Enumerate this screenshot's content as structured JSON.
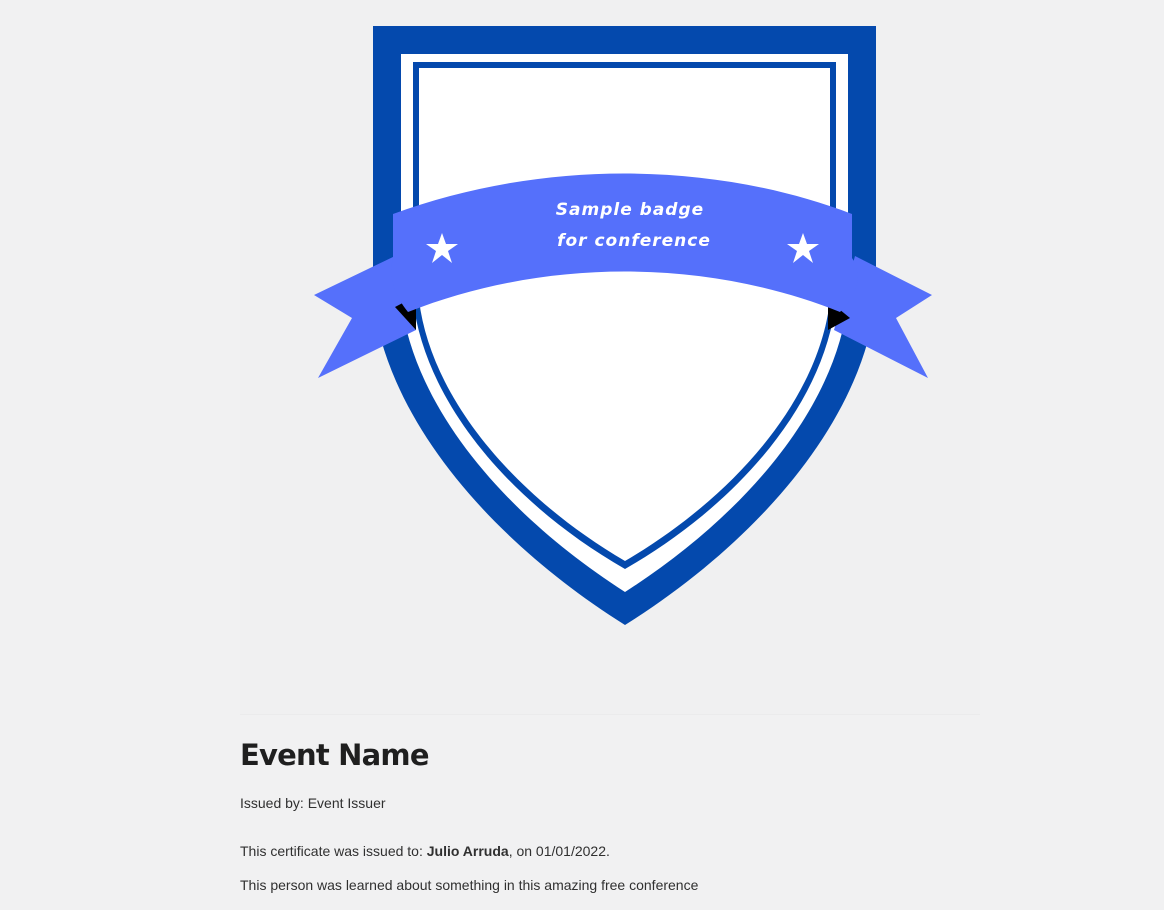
{
  "badge": {
    "ribbon_line1": "Sample badge",
    "ribbon_line2": "for conference",
    "colors": {
      "shield_blue": "#0449ad",
      "ribbon_blue": "#5570fb",
      "white": "#ffffff",
      "background": "#f0f0f1"
    }
  },
  "event": {
    "title": "Event Name",
    "issuer_prefix": "Issued by: ",
    "issuer_name": "Event Issuer",
    "cert_prefix": "This certificate was issued to: ",
    "recipient": "Julio Arruda",
    "cert_date_text": ", on 01/01/2022.",
    "description": "This person was learned about something in this amazing free conference"
  }
}
